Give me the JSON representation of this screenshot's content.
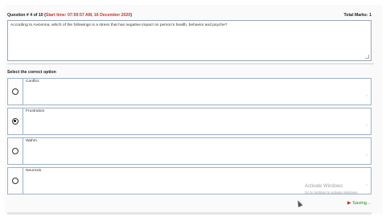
{
  "header": {
    "question_label": "Question # 4 of 10 (",
    "start_time": "Start time: 07:59:57 AM, 16 December 2020",
    "close_paren": ")",
    "total_marks": "Total Marks: 1"
  },
  "question_text": "According to Avicenna, which of the followings is a stress that has negative impact on person’s health, behavior and psyche?",
  "select_label": "Select the correct option",
  "options": [
    {
      "label": "Conflict",
      "selected": false
    },
    {
      "label": "Frustration",
      "selected": true
    },
    {
      "label": "Wahm",
      "selected": false
    },
    {
      "label": "Neurosis",
      "selected": false
    }
  ],
  "watermark": {
    "title": "Activate Windows",
    "subtitle": "Go to Settings to activate Windows."
  },
  "status": {
    "saving": "Saving..."
  }
}
